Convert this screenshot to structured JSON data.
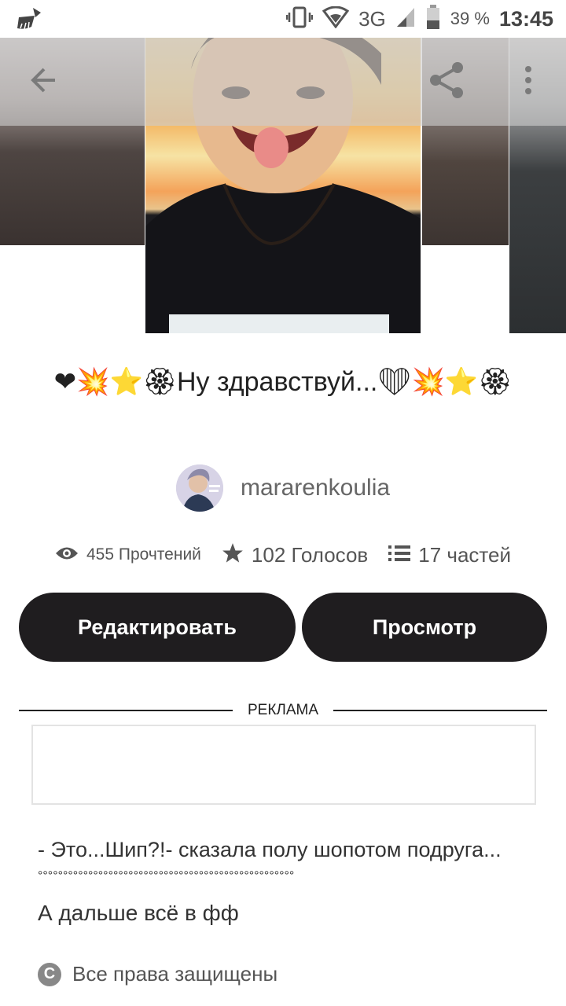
{
  "status_bar": {
    "network": "3G",
    "battery_percent": "39 %",
    "time": "13:45",
    "icons": [
      "cleaner-broom-icon",
      "vibrate-icon",
      "wifi-icon",
      "signal-icon",
      "battery-icon"
    ]
  },
  "toolbar": {
    "back_icon": "arrow-left-icon",
    "share_icon": "share-icon",
    "more_icon": "more-vertical-icon"
  },
  "story": {
    "title": "❤💥⭐🏵Ну здравствуй...❤💥⭐🏵",
    "author": "mararenkoulia",
    "reads": "455 Прочтений",
    "votes": "102 Голосов",
    "parts": "17 частей"
  },
  "actions": {
    "edit_label": "Редактировать",
    "preview_label": "Просмотр"
  },
  "ad": {
    "label": "РЕКЛАМА"
  },
  "description": {
    "line1": "- Это...Шип?!- сказала полу шопотом подруга...",
    "dots": "°°°°°°°°°°°°°°°°°°°°°°°°°°°°°°°°°°°°°°°°°°°°°°°°°°°",
    "line2": "А дальше всё в фф"
  },
  "copyright": {
    "text": "Все права защищены"
  },
  "colors": {
    "button_bg": "#1f1d1f",
    "text": "#333333",
    "muted": "#555555"
  }
}
